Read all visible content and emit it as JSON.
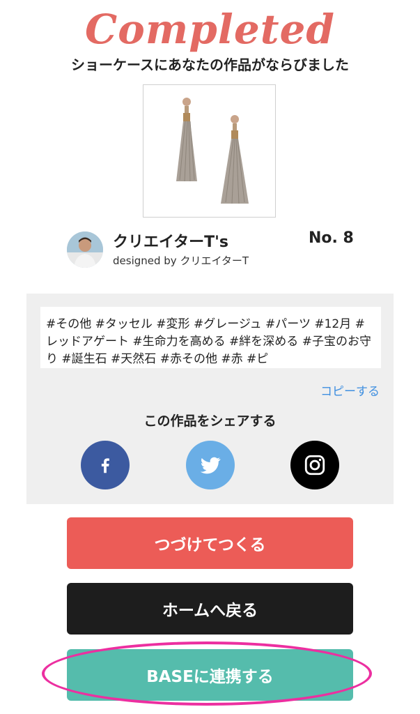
{
  "header": {
    "title": "Completed",
    "subtitle": "ショーケースにあなたの作品がならびました"
  },
  "product": {
    "image_desc_icon": "tassel-earrings-image"
  },
  "creator": {
    "name": "クリエイターT's",
    "designed_by": "designed by クリエイターT",
    "number": "No. 8"
  },
  "tags": {
    "text": "#その他 #タッセル #変形 #グレージュ #パーツ #12月 #レッドアゲート #生命力を高める #絆を深める #子宝のお守り #誕生石 #天然石 #赤その他 #赤 #ピ",
    "copy_label": "コピーする"
  },
  "share": {
    "title": "この作品をシェアする",
    "facebook_icon": "facebook-icon",
    "twitter_icon": "twitter-icon",
    "instagram_icon": "instagram-icon"
  },
  "buttons": {
    "continue_label": "つづけてつくる",
    "home_label": "ホームへ戻る",
    "base_label": "BASEに連携する"
  },
  "colors": {
    "accent": "#e36a63",
    "continue": "#ec5c57",
    "home": "#1d1d1d",
    "base": "#55bcac",
    "highlight": "#ec2fa0",
    "link": "#3f8fe0"
  }
}
